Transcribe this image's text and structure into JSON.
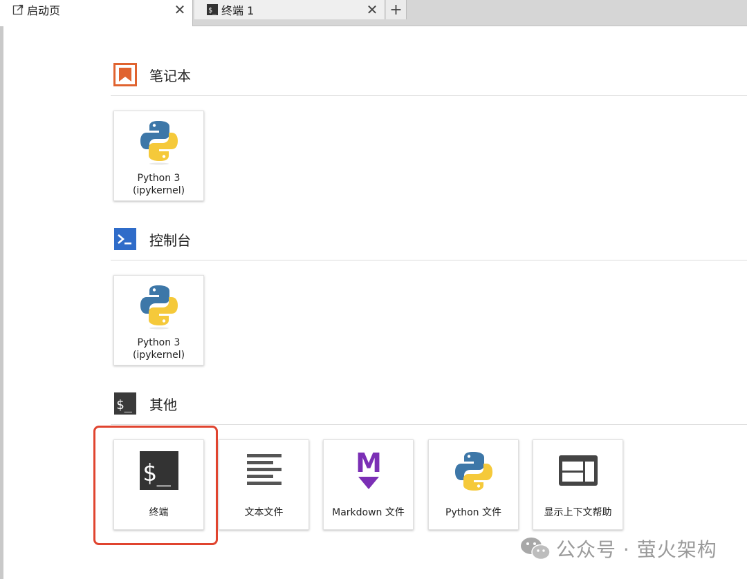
{
  "tabs": [
    {
      "label": "启动页",
      "icon": "launcher-icon",
      "close": "✕"
    },
    {
      "label": "终端 1",
      "icon": "terminal-icon",
      "close": "✕"
    }
  ],
  "add_tab": "+",
  "sections": {
    "notebook": {
      "title": "笔记本",
      "icon": "notebook-icon",
      "color": "#e0632f"
    },
    "console": {
      "title": "控制台",
      "icon": "console-icon",
      "color": "#2f6cc9"
    },
    "other": {
      "title": "其他",
      "icon": "other-terminal-icon",
      "color": "#3a3a3a"
    }
  },
  "notebook_cards": [
    {
      "line1": "Python 3",
      "line2": "(ipykernel)",
      "icon": "python-logo-icon"
    }
  ],
  "console_cards": [
    {
      "line1": "Python 3",
      "line2": "(ipykernel)",
      "icon": "python-logo-icon"
    }
  ],
  "other_cards": [
    {
      "label": "终端",
      "icon": "terminal-icon"
    },
    {
      "label": "文本文件",
      "icon": "text-file-icon"
    },
    {
      "label": "Markdown 文件",
      "icon": "markdown-icon"
    },
    {
      "label": "Python 文件",
      "icon": "python-logo-icon"
    },
    {
      "label": "显示上下文帮助",
      "icon": "context-help-icon"
    }
  ],
  "watermark": "公众号 · 萤火架构",
  "colors": {
    "highlight": "#e0442f",
    "markdown": "#7b2fb5",
    "python_blue": "#3d77a8",
    "python_yellow": "#f5c93a"
  }
}
